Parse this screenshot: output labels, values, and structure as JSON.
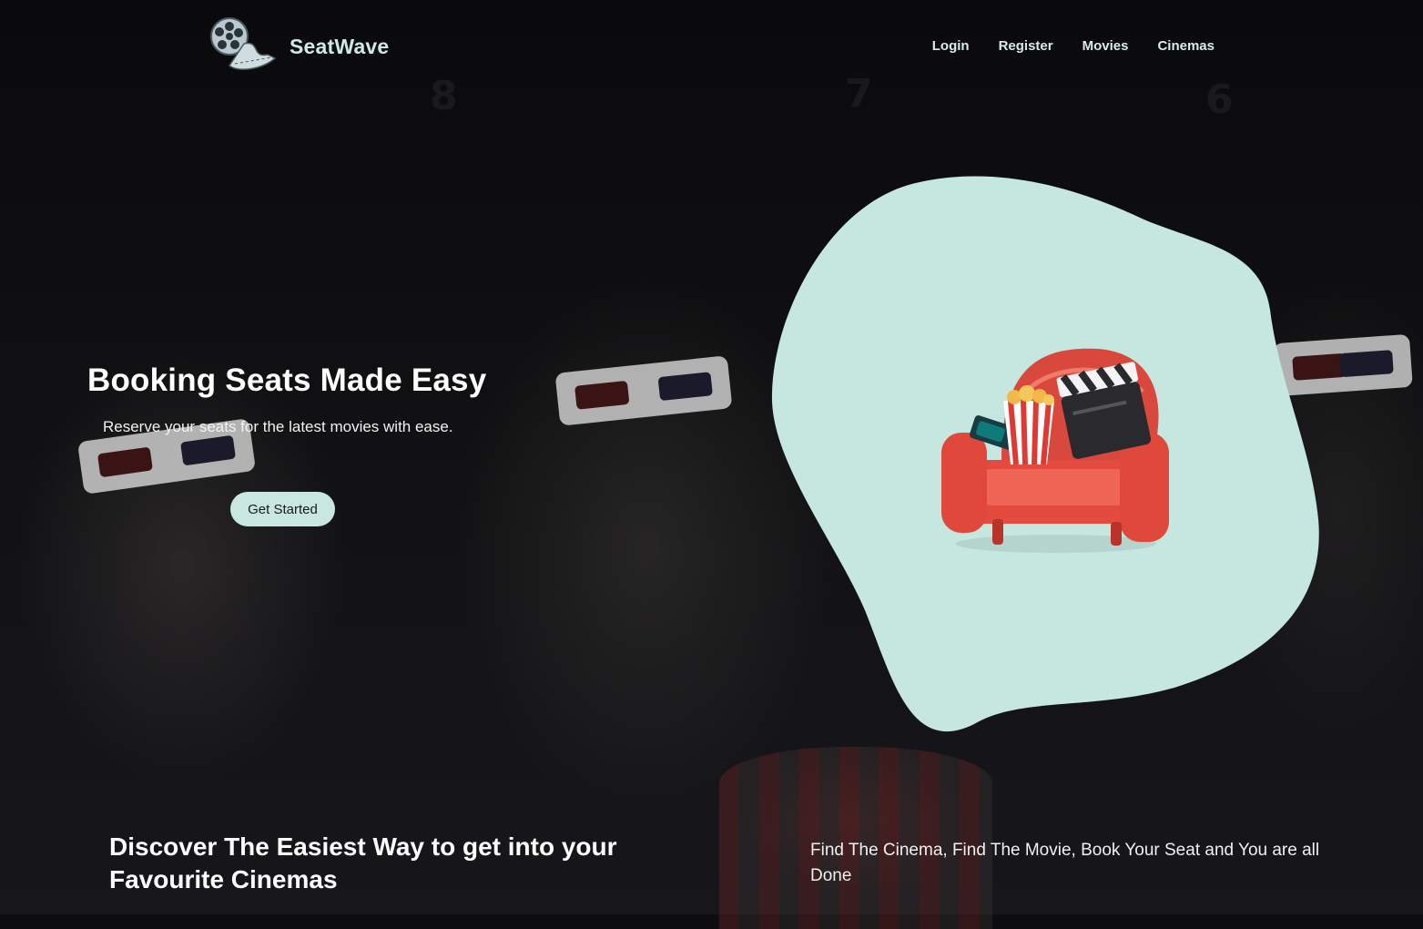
{
  "brand": {
    "name": "SeatWave",
    "logo_icon": "film-reel-icon"
  },
  "nav": {
    "items": [
      {
        "label": "Login"
      },
      {
        "label": "Register"
      },
      {
        "label": "Movies"
      },
      {
        "label": "Cinemas"
      }
    ]
  },
  "background": {
    "seat_numbers": [
      "8",
      "7",
      "6"
    ]
  },
  "hero": {
    "title": "Booking Seats Made Easy",
    "subtitle": "Reserve your seats for the latest movies with ease.",
    "cta_label": "Get Started",
    "illustration": "armchair-popcorn-clapperboard-icon",
    "blob_color": "#c6e6e0"
  },
  "about": {
    "heading": "Discover The Easiest Way to get into your Favourite Cinemas",
    "text": "Find The Cinema, Find The Movie, Book Your Seat and You are all Done"
  },
  "colors": {
    "accent": "#c9e7e1",
    "brand_text": "#cdebe4",
    "background": "#0d0d0f"
  }
}
